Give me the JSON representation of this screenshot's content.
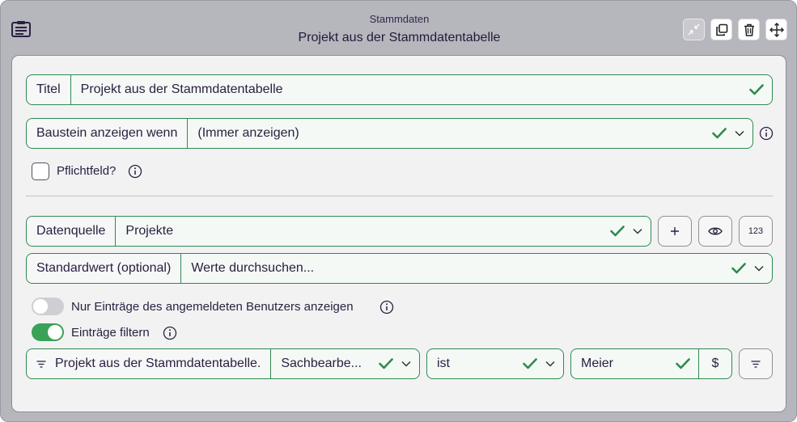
{
  "header": {
    "subtitle": "Stammdaten",
    "title": "Projekt aus der Stammdatentabelle"
  },
  "titel": {
    "label": "Titel",
    "value": "Projekt aus der Stammdatentabelle"
  },
  "baustein": {
    "label": "Baustein anzeigen wenn",
    "value": "(Immer anzeigen)"
  },
  "pflichtfeld": {
    "label": "Pflichtfeld?",
    "checked": false
  },
  "datenquelle": {
    "label": "Datenquelle",
    "value": "Projekte",
    "number_button": "123"
  },
  "standardwert": {
    "label": "Standardwert (optional)",
    "placeholder": "Werte durchsuchen..."
  },
  "toggles": {
    "nur_eigene": {
      "label": "Nur Einträge des angemeldeten Benutzers anzeigen",
      "on": false
    },
    "filtern": {
      "label": "Einträge filtern",
      "on": true
    }
  },
  "filter": {
    "field": "Projekt aus der Stammdatentabelle.",
    "subfield": "Sachbearbe...",
    "operator": "ist",
    "value": "Meier",
    "dollar": "$"
  },
  "colors": {
    "accent": "#2f8a4f",
    "toggle_on": "#3aa156",
    "toggle_off": "#cfcfd3"
  }
}
